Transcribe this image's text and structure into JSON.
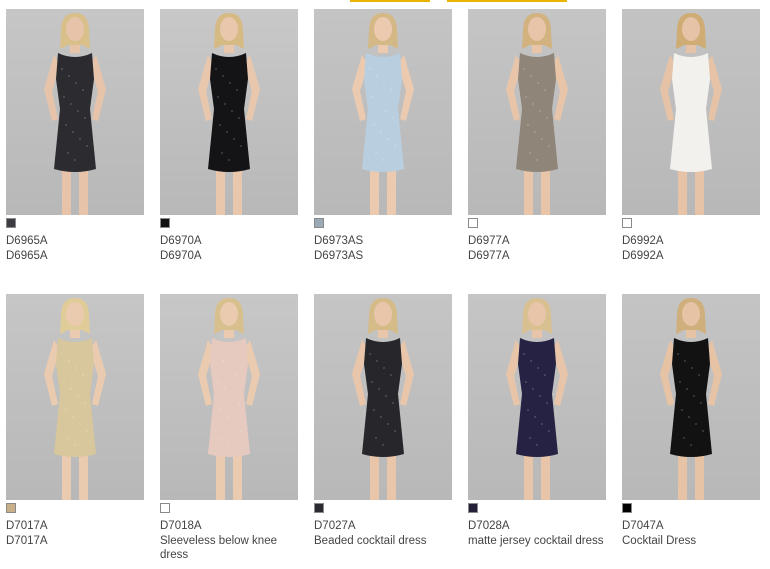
{
  "products": [
    {
      "code": "D6965A",
      "name": "D6965A",
      "swatch": "#3c3c44",
      "dress": "#2b2b30",
      "skin": "#e7c4a9",
      "hair": "#d9c08a",
      "bg": "#c6c6c6"
    },
    {
      "code": "D6970A",
      "name": "D6970A",
      "swatch": "#111111",
      "dress": "#141416",
      "skin": "#e9c7ad",
      "hair": "#d6ba84",
      "bg": "#c8c8c8"
    },
    {
      "code": "D6973AS",
      "name": "D6973AS",
      "swatch": "#9aa8b8",
      "dress": "#b9cfe0",
      "skin": "#ebcab0",
      "hair": "#d4b987",
      "bg": "#c4c4c4"
    },
    {
      "code": "D6977A",
      "name": "D6977A",
      "swatch": "#ffffff",
      "dress": "#8f8578",
      "skin": "#e8c5a9",
      "hair": "#d2b380",
      "bg": "#c5c5c5"
    },
    {
      "code": "D6992A",
      "name": "D6992A",
      "swatch": "#ffffff",
      "dress": "#f2f1ee",
      "skin": "#e6c3a6",
      "hair": "#cfac73",
      "bg": "#c3c3c3"
    },
    {
      "code": "D7017A",
      "name": "D7017A",
      "swatch": "#c9b08a",
      "dress": "#d8c79c",
      "skin": "#ebcbb0",
      "hair": "#e0cc99",
      "bg": "#c6c6c6"
    },
    {
      "code": "D7018A",
      "name": "Sleeveless below knee dress",
      "swatch": "#ffffff",
      "dress": "#e6c9bf",
      "skin": "#ebcbb0",
      "hair": "#d8bf8e",
      "bg": "#c7c7c7"
    },
    {
      "code": "D7027A",
      "name": "Beaded cocktail dress",
      "swatch": "#2a2a30",
      "dress": "#26262b",
      "skin": "#e9c6aa",
      "hair": "#d5bb88",
      "bg": "#c5c5c5"
    },
    {
      "code": "D7028A",
      "name": "matte jersey cocktail dress",
      "swatch": "#24203a",
      "dress": "#262243",
      "skin": "#e8c5a8",
      "hair": "#d8c090",
      "bg": "#c5c5c5"
    },
    {
      "code": "D7047A",
      "name": "Cocktail Dress",
      "swatch": "#000000",
      "dress": "#121212",
      "skin": "#e7c3a6",
      "hair": "#cfb07c",
      "bg": "#c4c4c4"
    }
  ]
}
